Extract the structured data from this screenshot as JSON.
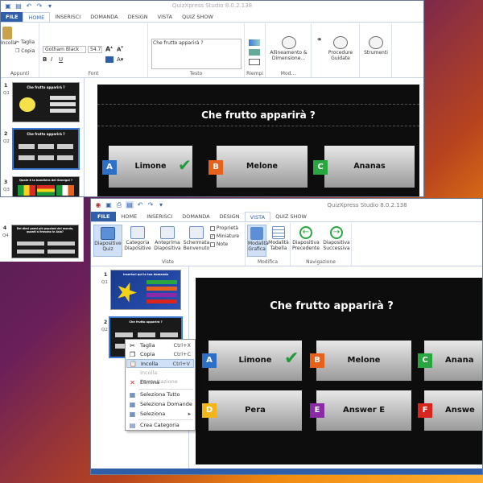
{
  "back_window": {
    "title": "QuizXpress Studio 8.0.2.138",
    "tabs": [
      "FILE",
      "HOME",
      "INSERISCI",
      "DOMANDA",
      "DESIGN",
      "VISTA",
      "QUIZ SHOW"
    ],
    "clipboard": {
      "paste": "Incolla",
      "cut": "Taglia",
      "copy": "Copia",
      "group": "Appunti"
    },
    "font": {
      "name": "Gotham Black",
      "size": "54.7",
      "group": "Font"
    },
    "text": {
      "value": "Che frutto apparirà ?",
      "group": "Testo"
    },
    "fill_group": "Riempi",
    "align": {
      "label": "Allineamento & Dimensione...",
      "group": "Mod..."
    },
    "procedures": "Procedure Guidate",
    "tools": "Strumenti",
    "slides": [
      {
        "num": "1",
        "q": "Q1",
        "title": "Che frutto apparirà ?"
      },
      {
        "num": "2",
        "q": "Q2",
        "title": "Che frutto apparirà ?"
      },
      {
        "num": "3",
        "q": "Q3",
        "title": "Quale è la bandiera del Senegal ?"
      },
      {
        "num": "4",
        "q": "Q4",
        "title": "Dei dieci paesi più popolosi del mondo, quanti si trovano in Asia?"
      }
    ],
    "slide": {
      "title": "Che frutto apparirà ?",
      "answers": [
        {
          "letter": "A",
          "text": "Limone",
          "color": "#2d6fc7"
        },
        {
          "letter": "B",
          "text": "Melone",
          "color": "#e8611c"
        },
        {
          "letter": "C",
          "text": "Ananas",
          "color": "#2aa640"
        }
      ]
    }
  },
  "front_window": {
    "title": "QuizXpress Studio 8.0.2.138",
    "tabs": [
      "FILE",
      "HOME",
      "INSERISCI",
      "DOMANDA",
      "DESIGN",
      "VISTA",
      "QUIZ SHOW"
    ],
    "views": [
      {
        "label": "Diapositive Quiz"
      },
      {
        "label": "Categoria Diapositive"
      },
      {
        "label": "Anteprima Diapositiva"
      },
      {
        "label": "Schermata Benvenuto"
      }
    ],
    "checks": [
      {
        "label": "Proprietà",
        "checked": false
      },
      {
        "label": "Miniature",
        "checked": true
      },
      {
        "label": "Note",
        "checked": false
      }
    ],
    "views_group": "Viste",
    "modify": [
      {
        "label": "Modalità Grafica"
      },
      {
        "label": "Modalità Tabella"
      }
    ],
    "modify_group": "Modifica",
    "nav": [
      {
        "label": "Diapositiva Precedente"
      },
      {
        "label": "Diapositiva Successiva"
      }
    ],
    "nav_group": "Navigazione",
    "slides": [
      {
        "num": "1",
        "q": "Q1",
        "title": "Inserisci qui la tua domanda"
      },
      {
        "num": "2",
        "q": "Q2",
        "title": "Che frutto apparirà ?"
      }
    ],
    "slide": {
      "title": "Che frutto apparirà ?",
      "answers": [
        {
          "letter": "A",
          "text": "Limone",
          "color": "#2d6fc7"
        },
        {
          "letter": "B",
          "text": "Melone",
          "color": "#e8611c"
        },
        {
          "letter": "C",
          "text": "Anana",
          "color": "#2aa640"
        },
        {
          "letter": "D",
          "text": "Pera",
          "color": "#f2b51a"
        },
        {
          "letter": "E",
          "text": "Answer E",
          "color": "#8a2aa6"
        },
        {
          "letter": "F",
          "text": "Answe",
          "color": "#d8261f"
        }
      ]
    }
  },
  "context_menu": [
    {
      "label": "Taglia",
      "key": "Ctrl+X",
      "icon": "✂",
      "disabled": false,
      "highlight": false
    },
    {
      "label": "Copia",
      "key": "Ctrl+C",
      "icon": "❐",
      "disabled": false,
      "highlight": false
    },
    {
      "label": "Incolla",
      "key": "Ctrl+V",
      "icon": "📋",
      "disabled": false,
      "highlight": true
    },
    {
      "label": "Incolla Formattazione",
      "key": "",
      "icon": "",
      "disabled": true,
      "highlight": false
    },
    {
      "label": "Elimina",
      "key": "",
      "icon": "✕",
      "disabled": false,
      "highlight": false
    },
    {
      "label": "Seleziona Tutto",
      "key": "",
      "icon": "▦",
      "disabled": false,
      "highlight": false
    },
    {
      "label": "Seleziona Domande",
      "key": "",
      "icon": "▦",
      "disabled": false,
      "highlight": false
    },
    {
      "label": "Seleziona",
      "key": "",
      "icon": "▦",
      "disabled": false,
      "highlight": false
    },
    {
      "label": "Crea Categoria",
      "key": "",
      "icon": "▤",
      "disabled": false,
      "highlight": false
    }
  ],
  "colors": {
    "accent": "#2e5fa8",
    "check": "#1f9a3a"
  }
}
